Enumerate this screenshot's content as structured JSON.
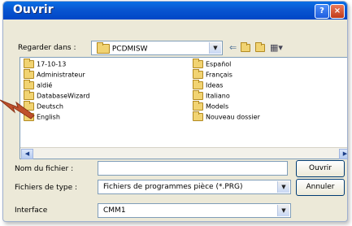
{
  "dialog": {
    "title": "Ouvrir",
    "help_icon": "?",
    "close_icon": "×"
  },
  "lookin": {
    "label": "Regarder dans :",
    "value": "PCDMISW"
  },
  "toolbar": {
    "back_icon": "back-arrow-icon",
    "up_icon": "up-folder-icon",
    "new_folder_icon": "new-folder-icon",
    "view_icon": "view-menu-icon"
  },
  "files": {
    "col1": [
      "17-10-13",
      "Administrateur",
      "aldié",
      "DatabaseWizard",
      "Deutsch",
      "English"
    ],
    "col2": [
      "Español",
      "Français",
      "Ideas",
      "Italiano",
      "Models",
      "Nouveau dossier"
    ]
  },
  "filename": {
    "label": "Nom du fichier :",
    "value": ""
  },
  "filetype": {
    "label": "Fichiers de type :",
    "value": "Fichiers de programmes pièce (*.PRG)"
  },
  "interface": {
    "label": "Interface",
    "value": "CMM1"
  },
  "buttons": {
    "open": "Ouvrir",
    "cancel": "Annuler"
  },
  "colors": {
    "title_bar": "#0a5fdb",
    "dialog_bg": "#ece9d8",
    "pointer_arrow": "#c0502c"
  }
}
